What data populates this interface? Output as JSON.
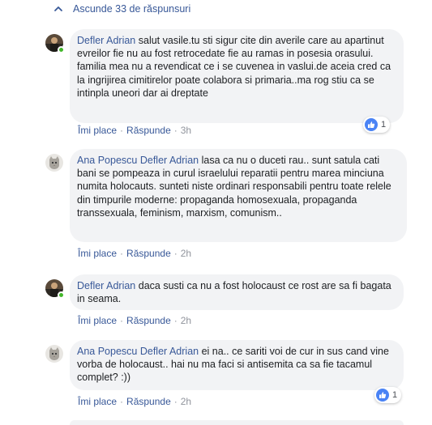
{
  "replies_toggle": {
    "label": "Ascunde 33 de răspunsuri",
    "icon": "chevron-up-icon"
  },
  "comments": [
    {
      "author": "Defler Adrian",
      "avatar": "user-photo-dark",
      "online": true,
      "text": "salut vasile.tu sti sigur cite din averile care au apartinut evreilor fie nu au fost retrocedate fie au ramas in posesia orasului. familia mea nu a revendicat ce i se cuvenea in vaslui.de aceia cred ca la ingrijirea cimitirelor poate colabora si primaria..ma rog stiu ca se intinpla uneori dar ai dreptate",
      "like_label": "Îmi place",
      "reply_label": "Răspunde",
      "time": "3h",
      "reactions": {
        "icon": "like-icon",
        "count": "1"
      }
    },
    {
      "author": "Ana Popescu",
      "avatar": "user-photo-cat",
      "online": false,
      "mention": "Defler Adrian",
      "text": "lasa ca nu o duceti rau.. sunt satula cati bani se pompeaza in curul israelului reparatii pentru marea minciuna numita holocauts. sunteti niste ordinari responsabili pentru toate relele din timpurile moderne: propaganda homosexuala, propaganda transsexuala, feminism, marxism, comunism..",
      "like_label": "Îmi place",
      "reply_label": "Răspunde",
      "time": "2h"
    },
    {
      "author": "Defler Adrian",
      "avatar": "user-photo-dark",
      "online": true,
      "text": "daca susti ca nu a fost holocaust ce rost are sa fi bagata in seama.",
      "like_label": "Îmi place",
      "reply_label": "Răspunde",
      "time": "2h"
    },
    {
      "author": "Ana Popescu",
      "avatar": "user-photo-cat",
      "online": false,
      "mention": "Defler Adrian",
      "text": "ei na.. ce sariti voi de cur in sus cand vine vorba de holocaust.. hai nu ma faci si antisemita ca sa fie tacamul complet? :))",
      "like_label": "Îmi place",
      "reply_label": "Răspunde",
      "time": "2h",
      "reactions": {
        "icon": "like-icon",
        "count": "1"
      }
    }
  ],
  "colors": {
    "link": "#385898",
    "bubble": "#f2f3f5",
    "meta": "#90949c",
    "online": "#42b72a",
    "like": "#4a83f5"
  }
}
